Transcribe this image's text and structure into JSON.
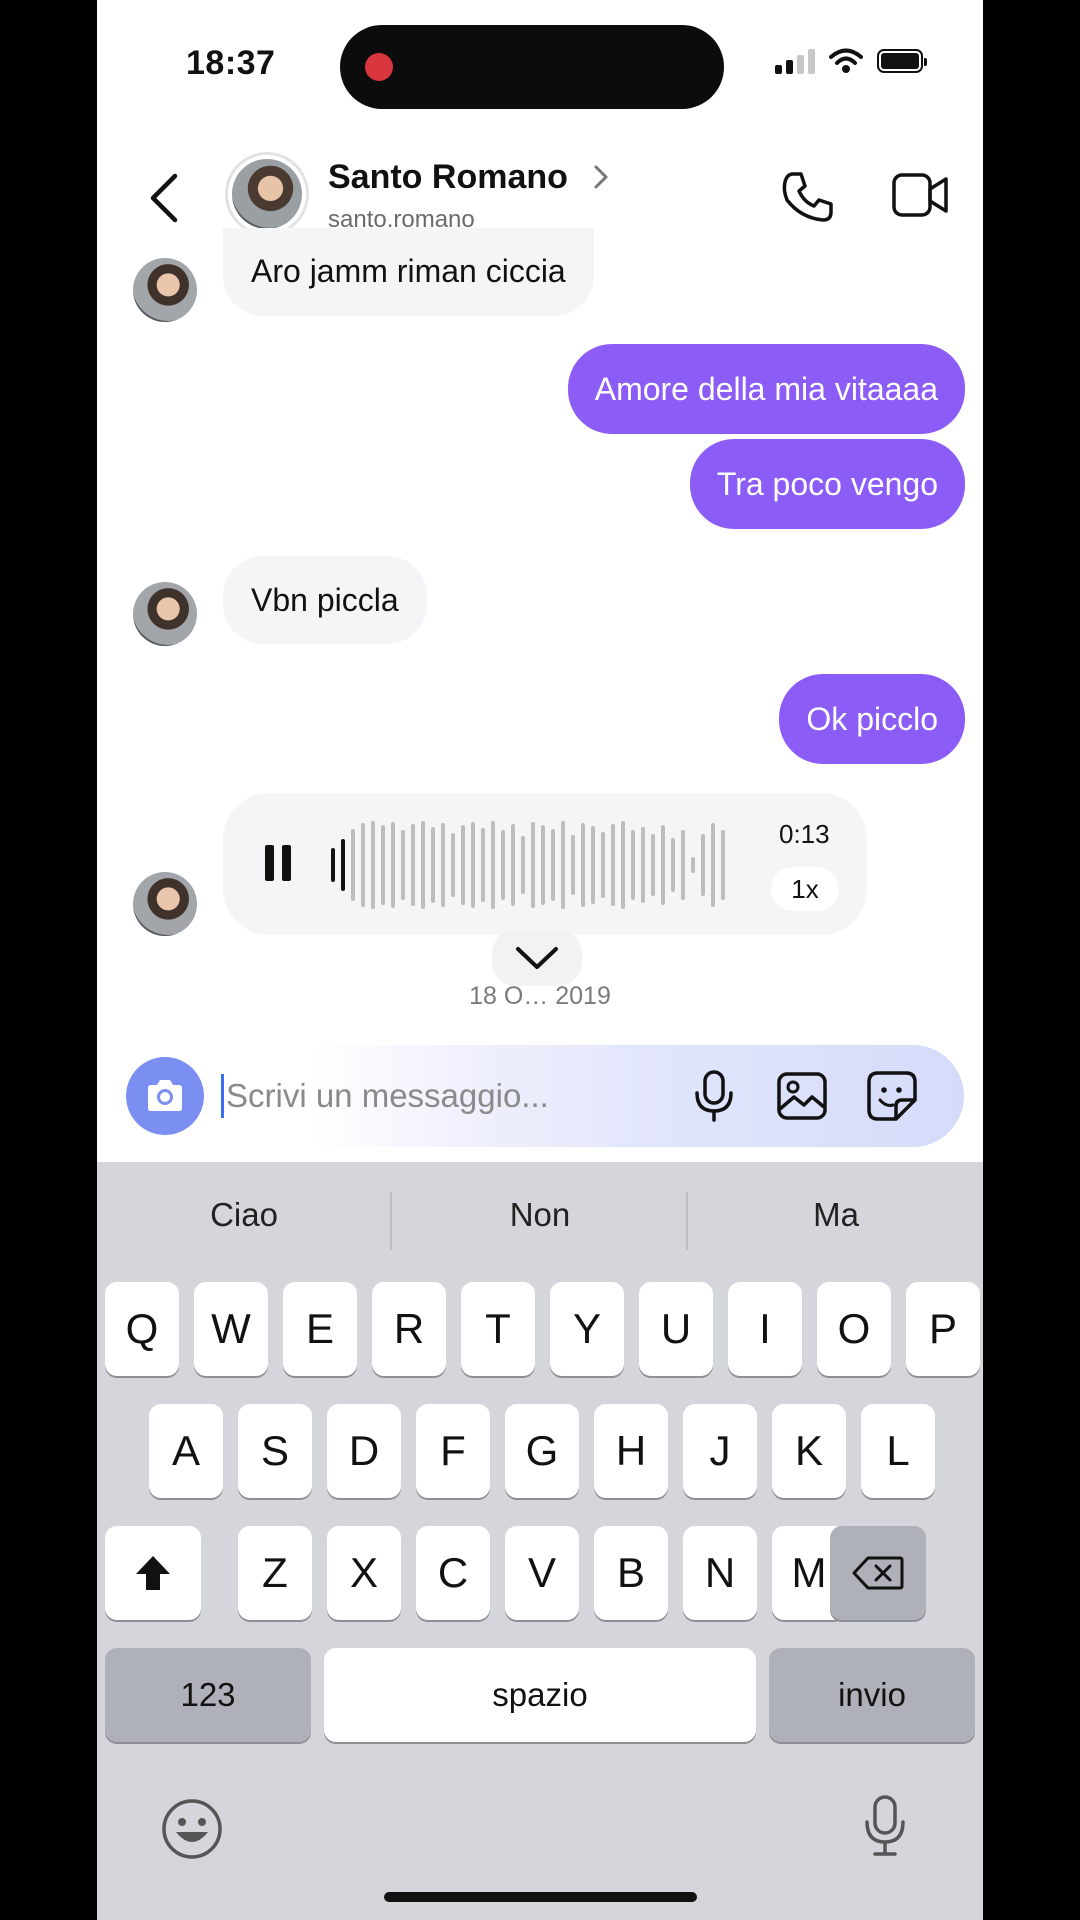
{
  "status_bar": {
    "time": "18:37"
  },
  "header": {
    "contact_name": "Santo Romano",
    "username": "santo.romano",
    "icons": [
      "back-chevron-icon",
      "chevron-right-icon",
      "phone-icon",
      "video-camera-icon"
    ]
  },
  "messages": [
    {
      "direction": "in",
      "text": "Aro jamm riman ciccia"
    },
    {
      "direction": "out",
      "text": "Amore della mia vitaaaa"
    },
    {
      "direction": "out",
      "text": "Tra poco vengo"
    },
    {
      "direction": "in",
      "text": "Vbn piccla"
    },
    {
      "direction": "out",
      "text": "Ok picclo"
    }
  ],
  "voice_message": {
    "duration": "0:13",
    "speed": "1x",
    "state": "playing",
    "progress": 0.04
  },
  "date_separator": "18 O… 2019",
  "composer": {
    "placeholder": "Scrivi un messaggio...",
    "accent_color": "#7b8ff2",
    "icons": [
      "camera-icon",
      "microphone-icon",
      "image-icon",
      "sticker-icon"
    ]
  },
  "colors": {
    "outgoing_bubble": "#8b5cf6",
    "incoming_bubble": "#f5f5f8"
  },
  "keyboard": {
    "suggestions": [
      "Ciao",
      "Non",
      "Ma"
    ],
    "row1": [
      "Q",
      "W",
      "E",
      "R",
      "T",
      "Y",
      "U",
      "I",
      "O",
      "P"
    ],
    "row2": [
      "A",
      "S",
      "D",
      "F",
      "G",
      "H",
      "J",
      "K",
      "L"
    ],
    "row3": [
      "Z",
      "X",
      "C",
      "V",
      "B",
      "N",
      "M"
    ],
    "numbers_key": "123",
    "space_key": "spazio",
    "return_key": "invio"
  }
}
